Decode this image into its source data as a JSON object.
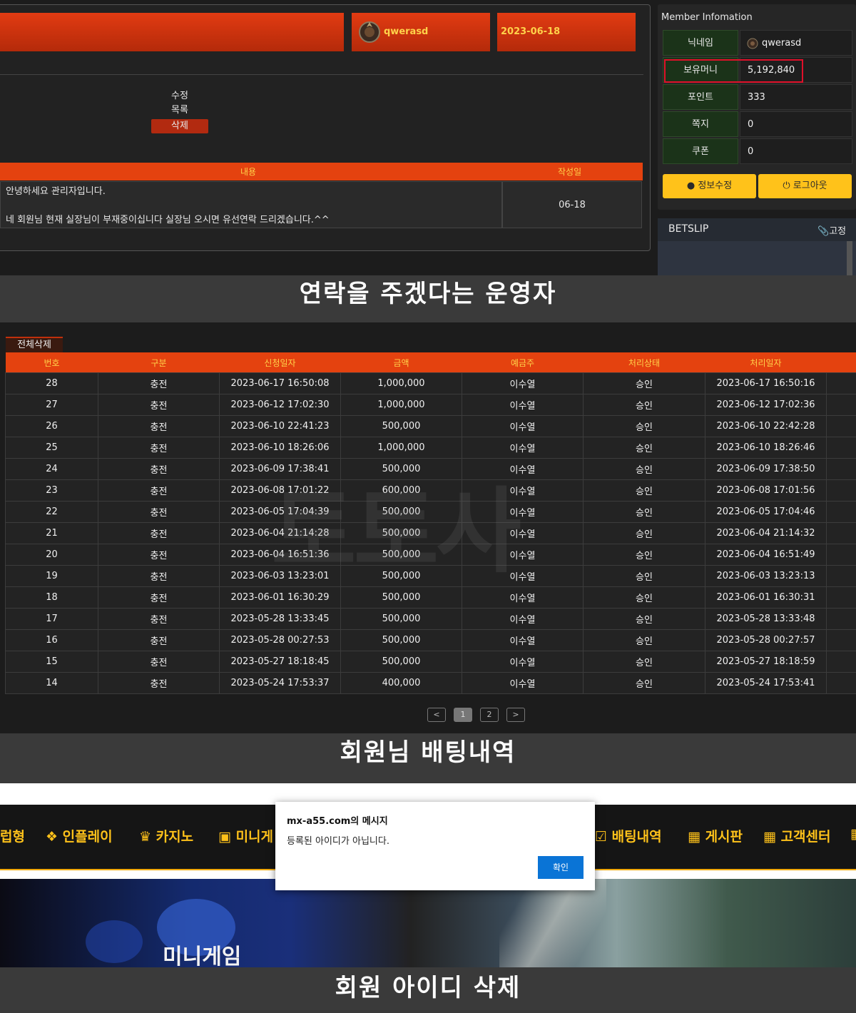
{
  "panel1": {
    "author": "qwerasd",
    "date": "2023-06-18",
    "actions": {
      "edit": "수정",
      "list": "목록",
      "delete": "삭제"
    },
    "table_headers": {
      "content": "내용",
      "written": "작성일"
    },
    "message_line1": "안녕하세요 관리자입니다.",
    "message_line2": "네 회원님 현재 실장님이 부재중이십니다 실장님 오시면 유선연락 드리겠습니다.^^",
    "message_date": "06-18",
    "member": {
      "title": "Member Infomation",
      "rows": [
        {
          "label": "닉네임",
          "value": "qwerasd"
        },
        {
          "label": "보유머니",
          "value": "5,192,840"
        },
        {
          "label": "포인트",
          "value": "333"
        },
        {
          "label": "쪽지",
          "value": "0"
        },
        {
          "label": "쿠폰",
          "value": "0"
        }
      ],
      "edit_button": "정보수정",
      "logout_button": "로그아웃"
    },
    "betslip": {
      "title": "BETSLIP",
      "fix": "고정"
    },
    "caption": "연락을 주겠다는 운영자"
  },
  "panel2": {
    "delete_all": "전체삭제",
    "headers": [
      "번호",
      "구분",
      "신청일자",
      "금액",
      "예금주",
      "처리상태",
      "처리일자"
    ],
    "rows": [
      [
        "28",
        "충전",
        "2023-06-17 16:50:08",
        "1,000,000",
        "이수열",
        "승인",
        "2023-06-17 16:50:16"
      ],
      [
        "27",
        "충전",
        "2023-06-12 17:02:30",
        "1,000,000",
        "이수열",
        "승인",
        "2023-06-12 17:02:36"
      ],
      [
        "26",
        "충전",
        "2023-06-10 22:41:23",
        "500,000",
        "이수열",
        "승인",
        "2023-06-10 22:42:28"
      ],
      [
        "25",
        "충전",
        "2023-06-10 18:26:06",
        "1,000,000",
        "이수열",
        "승인",
        "2023-06-10 18:26:46"
      ],
      [
        "24",
        "충전",
        "2023-06-09 17:38:41",
        "500,000",
        "이수열",
        "승인",
        "2023-06-09 17:38:50"
      ],
      [
        "23",
        "충전",
        "2023-06-08 17:01:22",
        "600,000",
        "이수열",
        "승인",
        "2023-06-08 17:01:56"
      ],
      [
        "22",
        "충전",
        "2023-06-05 17:04:39",
        "500,000",
        "이수열",
        "승인",
        "2023-06-05 17:04:46"
      ],
      [
        "21",
        "충전",
        "2023-06-04 21:14:28",
        "500,000",
        "이수열",
        "승인",
        "2023-06-04 21:14:32"
      ],
      [
        "20",
        "충전",
        "2023-06-04 16:51:36",
        "500,000",
        "이수열",
        "승인",
        "2023-06-04 16:51:49"
      ],
      [
        "19",
        "충전",
        "2023-06-03 13:23:01",
        "500,000",
        "이수열",
        "승인",
        "2023-06-03 13:23:13"
      ],
      [
        "18",
        "충전",
        "2023-06-01 16:30:29",
        "500,000",
        "이수열",
        "승인",
        "2023-06-01 16:30:31"
      ],
      [
        "17",
        "충전",
        "2023-05-28 13:33:45",
        "500,000",
        "이수열",
        "승인",
        "2023-05-28 13:33:48"
      ],
      [
        "16",
        "충전",
        "2023-05-28 00:27:53",
        "500,000",
        "이수열",
        "승인",
        "2023-05-28 00:27:57"
      ],
      [
        "15",
        "충전",
        "2023-05-27 18:18:45",
        "500,000",
        "이수열",
        "승인",
        "2023-05-27 18:18:59"
      ],
      [
        "14",
        "충전",
        "2023-05-24 17:53:37",
        "400,000",
        "이수열",
        "승인",
        "2023-05-24 17:53:41"
      ]
    ],
    "pagination": {
      "prev": "<",
      "pages": [
        "1",
        "2"
      ],
      "current": "1",
      "next": ">"
    },
    "watermark": "토토사",
    "caption": "회원님 배팅내역"
  },
  "panel3": {
    "nav": [
      "럽형",
      "인플레이",
      "카지노",
      "미니게",
      "배팅내역",
      "게시판",
      "고객센터"
    ],
    "banner_label": "미니게임",
    "dialog": {
      "title": "mx-a55.com의 메시지",
      "message": "등록된 아이디가 아닙니다.",
      "ok": "확인"
    },
    "caption": "회원 아이디 삭제"
  },
  "colors": {
    "accent": "#e4420f",
    "gold": "#ffc21a",
    "highlight": "#e0102a",
    "dialog_button": "#0a74d6"
  }
}
